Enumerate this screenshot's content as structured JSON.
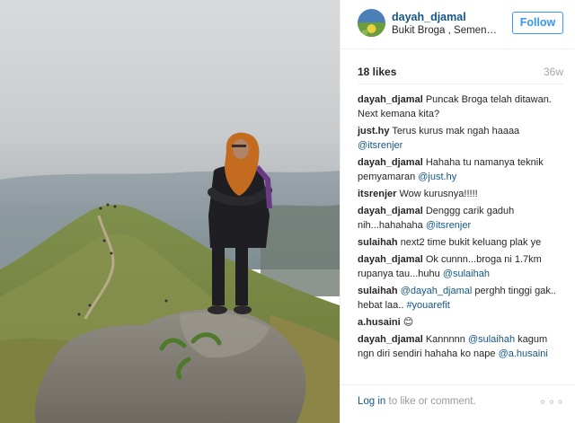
{
  "post": {
    "image_alt": "",
    "username": "dayah_djamal",
    "location": "Bukit Broga , Semenyih",
    "follow_label": "Follow",
    "likes": "18 likes",
    "age": "36w"
  },
  "comments": [
    {
      "user": "dayah_djamal",
      "text": "Puncak Broga telah ditawan. Next kemana kita?",
      "mention": ""
    },
    {
      "user": "just.hy",
      "text": "Terus kurus mak ngah haaaa",
      "mention": "@itsrenjer"
    },
    {
      "user": "dayah_djamal",
      "text": "Hahaha tu namanya teknik pemyamaran",
      "mention": "@just.hy"
    },
    {
      "user": "itsrenjer",
      "text": "Wow kurusnya!!!!!",
      "mention": ""
    },
    {
      "user": "dayah_djamal",
      "text": "Denggg carik gaduh nih...hahahaha",
      "mention": "@itsrenjer"
    },
    {
      "user": "sulaihah",
      "text": "next2 time bukit keluang plak ye",
      "mention": ""
    },
    {
      "user": "dayah_djamal",
      "text": "Ok cunnn...broga ni 1.7km rupanya tau...huhu",
      "mention": "@sulaihah"
    },
    {
      "user": "sulaihah",
      "text_mention_first": "@dayah_djamal",
      "text": "perghh tinggi gak.. hebat laa..",
      "mention": "#youarefit"
    },
    {
      "user": "a.husaini",
      "text": "😊",
      "mention": ""
    },
    {
      "user": "dayah_djamal",
      "text": "Kannnnn",
      "mention": "@sulaihah",
      "text2": "kagum ngn diri sendiri hahaha ko nape",
      "mention2": "@a.husaini"
    }
  ],
  "footer": {
    "login_link": "Log in",
    "login_text": " to like or comment.",
    "more": "∘∘∘"
  },
  "icons": {
    "more": "more-options-icon"
  }
}
